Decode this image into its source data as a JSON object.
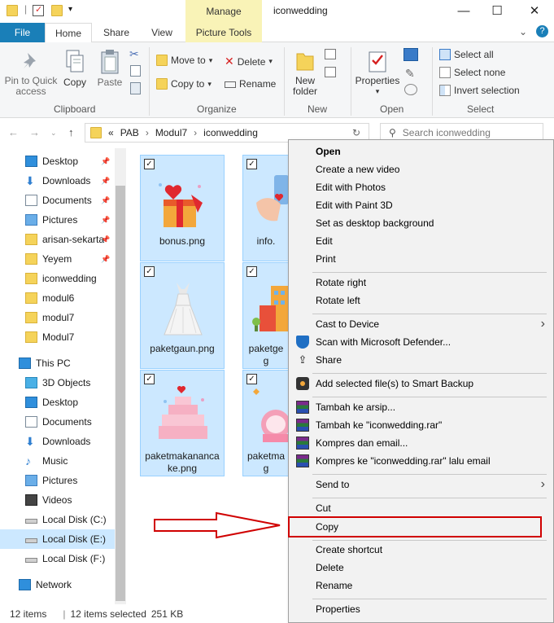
{
  "window": {
    "title": "iconwedding",
    "manage_label": "Manage",
    "minimize": "—",
    "maximize": "☐",
    "close": "✕"
  },
  "ribbon_tabs": {
    "file": "File",
    "home": "Home",
    "share": "Share",
    "view": "View",
    "picture_tools": "Picture Tools",
    "chevron": "⌄",
    "help": "?"
  },
  "clipboard": {
    "pin": "Pin to Quick access",
    "copy": "Copy",
    "paste": "Paste",
    "label": "Clipboard"
  },
  "organize": {
    "move_to": "Move to",
    "copy_to": "Copy to",
    "delete": "Delete",
    "rename": "Rename",
    "label": "Organize"
  },
  "new": {
    "new_folder": "New folder",
    "label": "New"
  },
  "open": {
    "properties": "Properties",
    "label": "Open"
  },
  "select": {
    "all": "Select all",
    "none": "Select none",
    "invert": "Invert selection",
    "label": "Select"
  },
  "address": {
    "prefix": "«",
    "parts": [
      "PAB",
      "Modul7",
      "iconwedding"
    ],
    "search_placeholder": "Search iconwedding"
  },
  "nav": {
    "quick_access": [
      {
        "label": "Desktop",
        "pinned": true
      },
      {
        "label": "Downloads",
        "pinned": true
      },
      {
        "label": "Documents",
        "pinned": true
      },
      {
        "label": "Pictures",
        "pinned": true
      },
      {
        "label": "arisan-sekarta",
        "pinned": true
      },
      {
        "label": "Yeyem",
        "pinned": true
      },
      {
        "label": "iconwedding",
        "pinned": false
      },
      {
        "label": "modul6",
        "pinned": false
      },
      {
        "label": "modul7",
        "pinned": false
      },
      {
        "label": "Modul7",
        "pinned": false
      }
    ],
    "this_pc": "This PC",
    "pc_items": [
      "3D Objects",
      "Desktop",
      "Documents",
      "Downloads",
      "Music",
      "Pictures",
      "Videos",
      "Local Disk (C:)",
      "Local Disk (E:)",
      "Local Disk (F:)"
    ],
    "network": "Network"
  },
  "files": [
    {
      "name": "bonus.png"
    },
    {
      "name": "info."
    },
    {
      "name": "paketgaun.png"
    },
    {
      "name": "paketge",
      "name2": "g"
    },
    {
      "name": "paketmakananca",
      "name2": "ke.png"
    },
    {
      "name": "paketma",
      "name2": "g"
    }
  ],
  "status": {
    "items": "12 items",
    "selected": "12 items selected",
    "size": "251 KB"
  },
  "context_menu": {
    "open": "Open",
    "create_video": "Create a new video",
    "edit_photos": "Edit with Photos",
    "edit_paint3d": "Edit with Paint 3D",
    "set_bg": "Set as desktop background",
    "edit": "Edit",
    "print": "Print",
    "rotate_right": "Rotate right",
    "rotate_left": "Rotate left",
    "cast": "Cast to Device",
    "defender": "Scan with Microsoft Defender...",
    "share": "Share",
    "smart_backup": "Add selected file(s) to Smart Backup",
    "arsip": "Tambah ke arsip...",
    "tambah_rar": "Tambah ke \"iconwedding.rar\"",
    "kompres_email": "Kompres dan email...",
    "kompres_rar_email": "Kompres ke \"iconwedding.rar\" lalu email",
    "send_to": "Send to",
    "cut": "Cut",
    "copy": "Copy",
    "create_shortcut": "Create shortcut",
    "delete": "Delete",
    "rename": "Rename",
    "properties": "Properties"
  },
  "colors": {
    "accent": "#1a7fb8",
    "selection": "#cce8ff",
    "highlight_box": "#d00000",
    "manage": "#f9f3b7"
  }
}
